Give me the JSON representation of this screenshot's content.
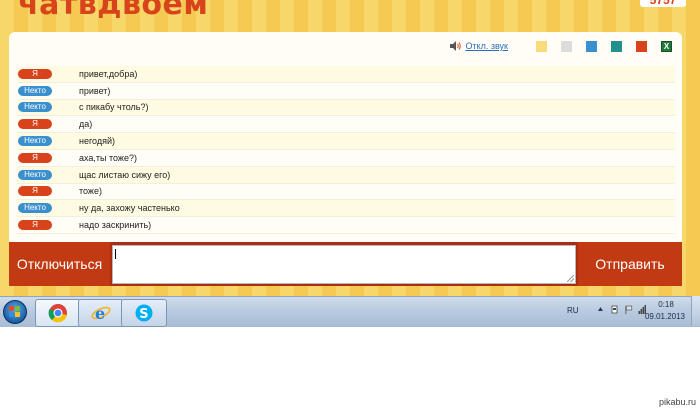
{
  "header": {
    "logo": "чатвдвоем",
    "counter": "5757"
  },
  "toolbar": {
    "sound_label": "Откл. звук",
    "themes": [
      {
        "name": "yellow",
        "color": "#f9db7b"
      },
      {
        "name": "gray",
        "color": "#dcdcdc"
      },
      {
        "name": "blue",
        "color": "#3a8fcf"
      },
      {
        "name": "teal",
        "color": "#23908c"
      },
      {
        "name": "red",
        "color": "#d8431c"
      }
    ],
    "export_label": "X"
  },
  "chat": {
    "messages": [
      {
        "author": "Я",
        "role": "me",
        "text": "привет,добра)"
      },
      {
        "author": "Некто",
        "role": "stranger",
        "text": "привет)"
      },
      {
        "author": "Некто",
        "role": "stranger",
        "text": "с пикабу чтоль?)"
      },
      {
        "author": "Я",
        "role": "me",
        "text": "да)"
      },
      {
        "author": "Некто",
        "role": "stranger",
        "text": "негодяй)"
      },
      {
        "author": "Я",
        "role": "me",
        "text": "аха,ты тоже?)"
      },
      {
        "author": "Некто",
        "role": "stranger",
        "text": "щас листаю сижу его)"
      },
      {
        "author": "Я",
        "role": "me",
        "text": "тоже)"
      },
      {
        "author": "Некто",
        "role": "stranger",
        "text": "ну да, захожу частенько"
      },
      {
        "author": "Я",
        "role": "me",
        "text": "надо заскринить)"
      }
    ]
  },
  "bottom": {
    "disconnect_label": "Отключиться",
    "send_label": "Отправить",
    "input_value": ""
  },
  "taskbar": {
    "apps": [
      "chrome-icon",
      "ie-icon",
      "skype-icon"
    ],
    "language": "RU",
    "time": "0:18",
    "date": "09.01.2013"
  },
  "watermark": "pikabu.ru",
  "colors": {
    "accent": "#d8431c",
    "stranger": "#3a8fcf",
    "bottom_bar": "#c23a13"
  }
}
